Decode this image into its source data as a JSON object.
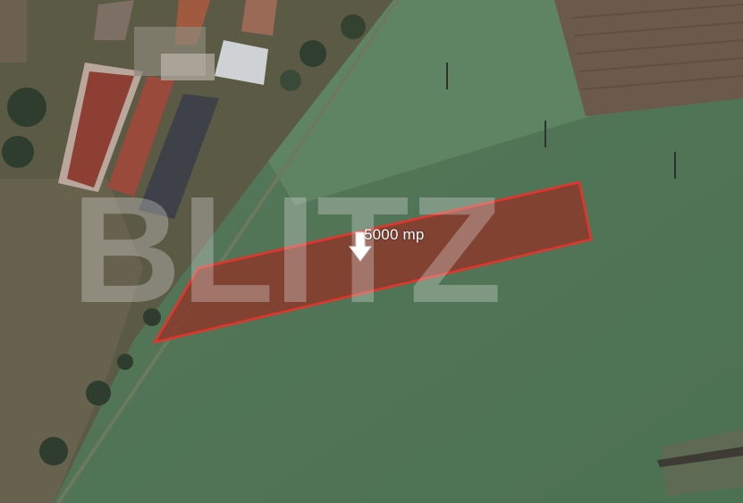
{
  "map": {
    "parcel": {
      "area_label": "5000 mp",
      "outline_color": "#e8322b",
      "fill_color": "#8a3a2c"
    },
    "watermark": {
      "text": "BLITZ"
    },
    "markers": [
      {
        "icon": "down-arrow-icon"
      }
    ]
  }
}
